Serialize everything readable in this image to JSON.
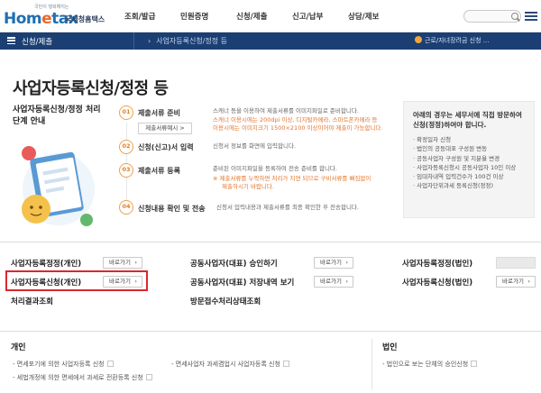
{
  "header": {
    "logo_tagline": "국민이 행복해지는",
    "logo_text": "Hometax",
    "logo_sub": "국세청홈택스",
    "gnb": [
      "조회/발급",
      "민원증명",
      "신청/제출",
      "신고/납부",
      "상담/제보"
    ]
  },
  "navbar": {
    "current": "신청/제출",
    "breadcrumb": "사업자등록신청/정정 등",
    "notice": "근로/자녀장려금 신청 ..."
  },
  "page": {
    "title": "사업자등록신청/정정 등",
    "process_title": "사업자등록신청/정정 처리단계 안내"
  },
  "steps": [
    {
      "num": "01",
      "label": "제출서류 준비",
      "desc": [
        "스캐너 등을 이용하여 제출서류를 이미지파일로 준비합니다."
      ],
      "note": [
        "스캐너 이용시에는 200dpi 이상, 디지털카메라, 스마트폰카메라 등",
        "이용시에는 이미지크기 1500×2100 이상이어야 제출이 가능합니다."
      ],
      "button": "제출서류예시 >"
    },
    {
      "num": "02",
      "label": "신청(신고)서 입력",
      "desc": [
        "신청서 정보를 화면에 입력합니다."
      ]
    },
    {
      "num": "03",
      "label": "제출서류 등록",
      "desc": [
        "준비된 이미지파일을 등록하여 전송 준비를 합니다."
      ],
      "note": [
        "※ 제출서류를 누락하면 처리가 지연 되므로 구비서류를 빠짐없이",
        "제출하시기 바랍니다."
      ]
    },
    {
      "num": "04",
      "label": "신청내용 확인 및 전송",
      "desc": [
        "신청서 입력내용과 제출서류를 최종 확인한 후 전송합니다."
      ]
    }
  ],
  "info_box": {
    "title": "아래의 경우는 세무서에 직접 방문하여 신청(정정)하여야 합니다.",
    "items": [
      "확정일자 신청",
      "법인의 공동대표 구성원 변동",
      "공동사업자 구성원 및 지분율 변경",
      "사업자등록신청시 공동사업자 10인 이상",
      "임대차내역 입력건수가 100건 이상",
      "사업자단위과세 등록신청(정정)"
    ]
  },
  "quick": {
    "go_label": "바로가기",
    "col1": [
      "사업자등록정정(개인)",
      "사업자등록신청(개인)",
      "처리결과조회"
    ],
    "col2": [
      "공동사업자(대표) 승인하기",
      "공동사업자(대표) 저장내역 보기",
      "방문접수처리상태조회"
    ],
    "col3": [
      "사업자등록정정(법인)",
      "사업자등록신청(법인)"
    ]
  },
  "bottom": {
    "personal": "개인",
    "corporate": "법인",
    "personal_links": [
      "면세포기에 의한 사업자등록 신청",
      "면세사업자 과세겸업시 사업자등록 신청",
      "세법개정에 의한 면세에서 과세로 전환등록 신청"
    ],
    "corporate_links": [
      "법인으로 보는 단체의 승인신청"
    ]
  },
  "colors": {
    "navy": "#1b3f73",
    "brand_blue": "#1f6fb3",
    "accent_orange": "#e9692c",
    "highlight_red": "#d9282f"
  }
}
